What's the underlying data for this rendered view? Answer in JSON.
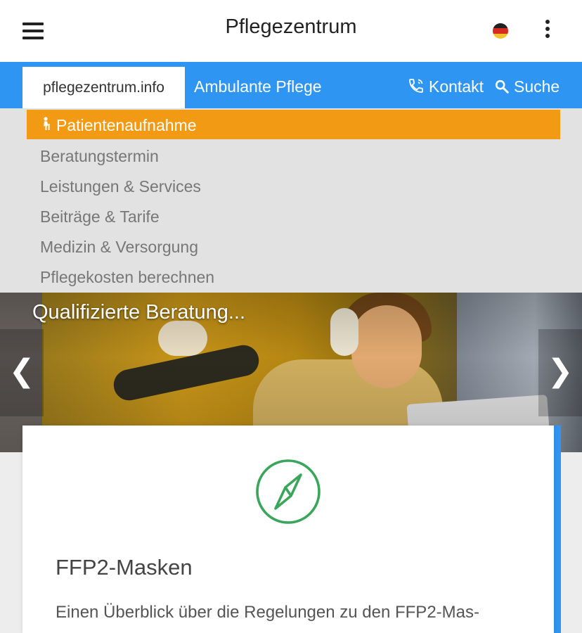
{
  "appbar": {
    "title": "Pflegezentrum",
    "menu_icon": "hamburger-icon",
    "language_icon": "german-flag-icon",
    "overflow_icon": "more-vertical-icon"
  },
  "navbar": {
    "home_tab": "pflegezentrum.info",
    "section_tab": "Ambulante Pflege",
    "contact_label": "Kontakt",
    "search_label": "Suche",
    "accent_color": "#2f95f2"
  },
  "dropdown": {
    "active_item": "Patientenaufnahme",
    "active_color": "#f39a14",
    "items": [
      "Beratungstermin",
      "Leistungen & Services",
      "Beiträge & Tarife",
      "Medizin & Versorgung",
      "Pflegekosten berechnen"
    ]
  },
  "hero": {
    "caption": "Qualifizierte Beratung...",
    "prev_label": "❮",
    "next_label": "❯"
  },
  "card": {
    "icon": "compass-icon",
    "icon_color": "#3aa55b",
    "title": "FFP2-Masken",
    "text": "Einen Überblick über die Regelungen zu den FFP2-Mas-"
  }
}
